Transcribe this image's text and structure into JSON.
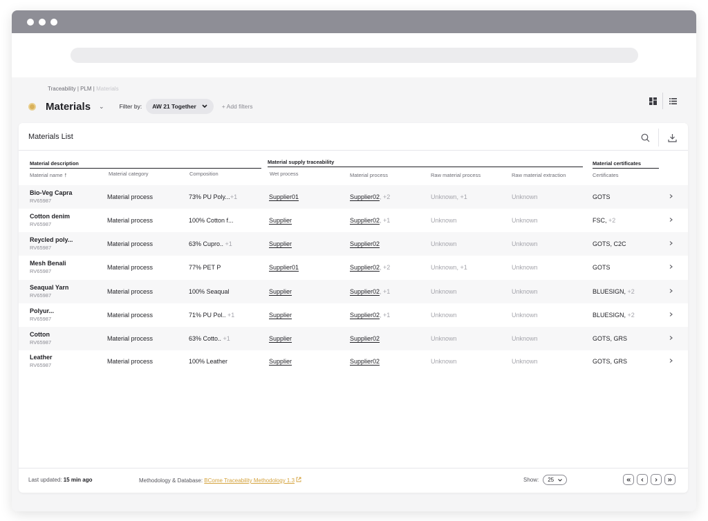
{
  "breadcrumb": {
    "path": "Traceability | PLM | ",
    "current": "Materials"
  },
  "page": {
    "title": "Materials",
    "filter_label": "Filter by:",
    "filter_value": "AW 21 Together",
    "add_filters": "+ Add filters"
  },
  "card": {
    "title": "Materials List"
  },
  "groups": {
    "description": "Material description",
    "supply": "Material supply traceability",
    "certificates": "Material certificates"
  },
  "columns": {
    "name": "Material name",
    "sort_arrow": "↑",
    "category": "Material category",
    "composition": "Composition",
    "wet": "Wet process",
    "process": "Material process",
    "raw_process": "Raw material process",
    "raw_extraction": "Raw material extraction",
    "certificates": "Certificates"
  },
  "rows": [
    {
      "name": "Bio-Veg Capra",
      "code": "RV65987",
      "category": "Material process",
      "composition": "73% PU Poly...",
      "comp_more": "+1",
      "wet": "Supplier01",
      "process": "Supplier02",
      "process_more": ", +2",
      "raw_process": "Unknown, +1",
      "raw_extraction": "Unknown",
      "certs": "GOTS",
      "certs_more": ""
    },
    {
      "name": "Cotton denim",
      "code": "RV65987",
      "category": "Material process",
      "composition": "100% Cotton f...",
      "comp_more": "",
      "wet": "Supplier",
      "process": "Supplier02",
      "process_more": ", +1",
      "raw_process": "Unknown",
      "raw_extraction": "Unknown",
      "certs": "FSC,",
      "certs_more": " +2"
    },
    {
      "name": "Reycled poly...",
      "code": "RV65987",
      "category": "Material process",
      "composition": "63% Cupro..",
      "comp_more": " +1",
      "wet": "Supplier",
      "process": "Supplier02",
      "process_more": "",
      "raw_process": "Unknown",
      "raw_extraction": "Unknown",
      "certs": "GOTS, C2C",
      "certs_more": ""
    },
    {
      "name": "Mesh Benali",
      "code": "RV65987",
      "category": "Material process",
      "composition": "77% PET P",
      "comp_more": "",
      "wet": "Supplier01",
      "process": "Supplier02",
      "process_more": ", +2",
      "raw_process": "Unknown, +1",
      "raw_extraction": "Unknown",
      "certs": "GOTS",
      "certs_more": ""
    },
    {
      "name": "Seaqual Yarn",
      "code": "RV65987",
      "category": "Material process",
      "composition": "100% Seaqual",
      "comp_more": "",
      "wet": "Supplier",
      "process": "Supplier02",
      "process_more": ", +1",
      "raw_process": "Unknown",
      "raw_extraction": "Unknown",
      "certs": "BLUESIGN,",
      "certs_more": " +2"
    },
    {
      "name": "Polyur...",
      "code": "RV65987",
      "category": "Material process",
      "composition": "71% PU Pol..",
      "comp_more": " +1",
      "wet": "Supplier",
      "process": "Supplier02",
      "process_more": ", +1",
      "raw_process": "Unknown",
      "raw_extraction": "Unknown",
      "certs": "BLUESIGN,",
      "certs_more": " +2"
    },
    {
      "name": "Cotton",
      "code": "RV65987",
      "category": "Material process",
      "composition": "63% Cotto..",
      "comp_more": " +1",
      "wet": "Supplier",
      "process": "Supplier02",
      "process_more": "",
      "raw_process": "Unknown",
      "raw_extraction": "Unknown",
      "certs": "GOTS, GRS",
      "certs_more": ""
    },
    {
      "name": "Leather",
      "code": "RV65987",
      "category": "Material process",
      "composition": "100% Leather",
      "comp_more": "",
      "wet": "Supplier",
      "process": "Supplier02",
      "process_more": "",
      "raw_process": "Unknown",
      "raw_extraction": "Unknown",
      "certs": "GOTS, GRS",
      "certs_more": ""
    }
  ],
  "footer": {
    "updated_label": "Last updated:",
    "updated_value": "15 min ago",
    "method_label": "Methodology & Database:",
    "method_link": "BCome Traceability Methodology 1.3",
    "show_label": "Show:",
    "show_value": "25"
  },
  "colors": {
    "accent": "#d4a23c",
    "titlebar": "#8e8e96",
    "status_dot": "#d9b15a"
  },
  "icons": [
    "chevron-down-icon",
    "grid-view-icon",
    "list-view-icon",
    "search-icon",
    "download-icon",
    "chevron-right-icon",
    "external-link-icon",
    "first-page-icon",
    "prev-page-icon",
    "next-page-icon",
    "last-page-icon"
  ]
}
